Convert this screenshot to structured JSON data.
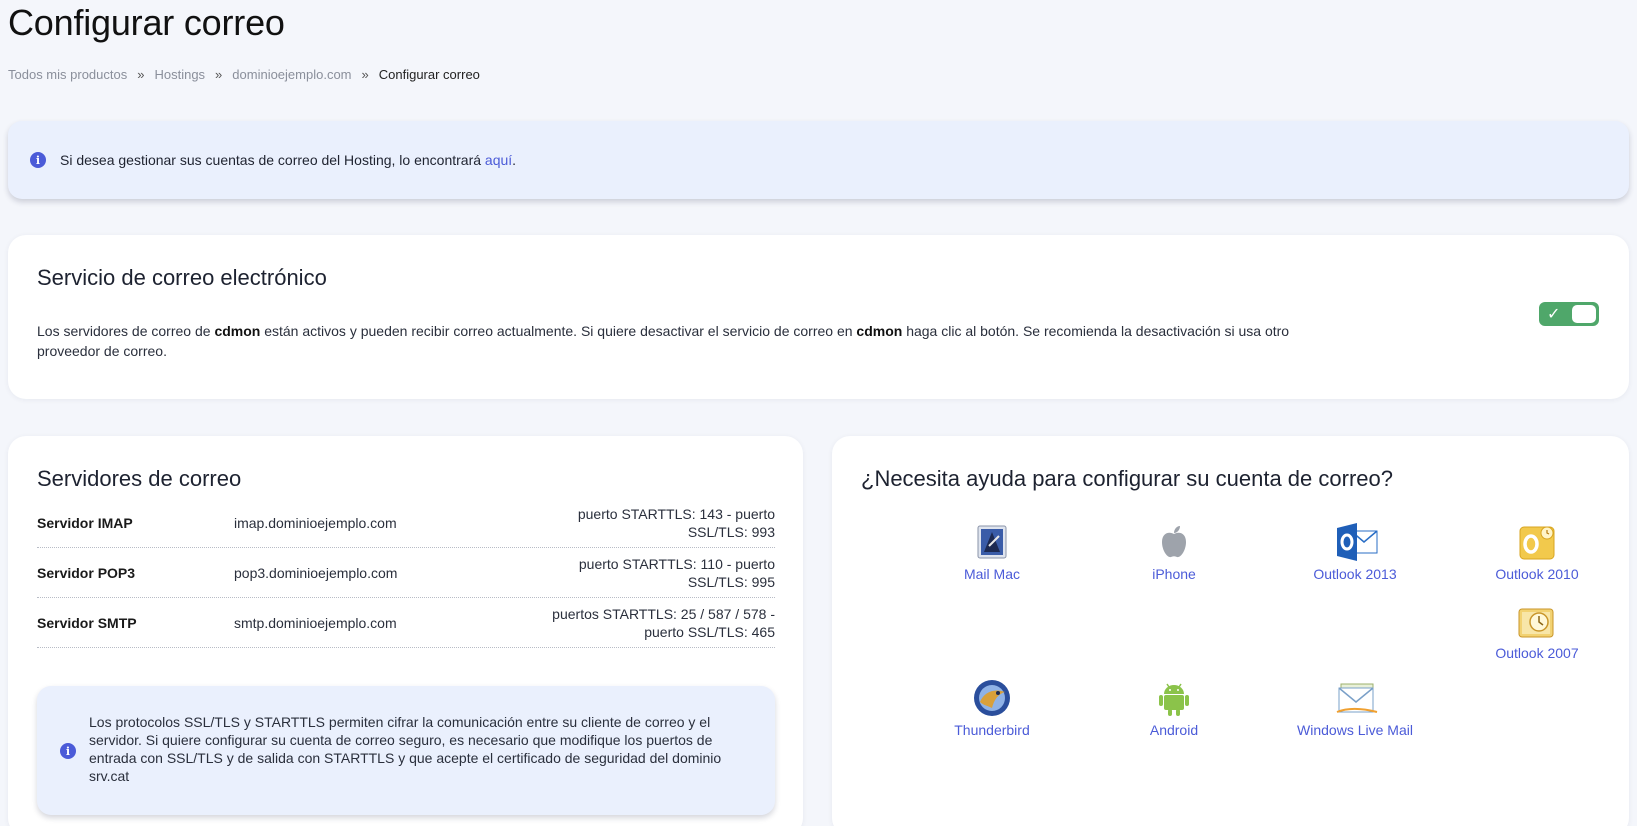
{
  "page_title": "Configurar correo",
  "breadcrumb": [
    {
      "label": "Todos mis productos"
    },
    {
      "label": "Hostings"
    },
    {
      "label": "dominioejemplo.com"
    },
    {
      "label": "Configurar correo"
    }
  ],
  "breadcrumb_separator": "»",
  "banner": {
    "text": "Si desea gestionar sus cuentas de correo del Hosting, lo encontrará ",
    "link": "aquí",
    "suffix": ".",
    "icon": "info-icon"
  },
  "service": {
    "title": "Servicio de correo electrónico",
    "desc_1": "Los servidores de correo de ",
    "brand": "cdmon",
    "desc_2": " están activos y pueden recibir correo actualmente. Si quiere desactivar el servicio de correo en ",
    "desc_3": " haga clic al botón. Se recomienda la desactivación si usa otro proveedor de correo.",
    "toggle_state": "on",
    "toggle_color": "#4fa76a"
  },
  "servers": {
    "title": "Servidores de correo",
    "rows": [
      {
        "name": "Servidor IMAP",
        "host": "imap.dominioejemplo.com",
        "ports": "puerto STARTTLS: 143 - puerto SSL/TLS: 993"
      },
      {
        "name": "Servidor POP3",
        "host": "pop3.dominioejemplo.com",
        "ports": "puerto STARTTLS: 110 - puerto SSL/TLS: 995"
      },
      {
        "name": "Servidor SMTP",
        "host": "smtp.dominioejemplo.com",
        "ports": "puertos STARTTLS: 25 / 587 / 578 - puerto SSL/TLS: 465"
      }
    ],
    "note": "Los protocolos SSL/TLS y STARTTLS permiten cifrar la comunicación entre su cliente de correo y el servidor. Si quiere configurar su cuenta de correo seguro, es necesario que modifique los puertos de entrada con SSL/TLS y de salida con STARTTLS y que acepte el certificado de seguridad del dominio srv.cat"
  },
  "help": {
    "title": "¿Necesita ayuda para configurar su cuenta de correo?",
    "clients": [
      {
        "label": "Mail Mac",
        "icon": "mail-mac-icon"
      },
      {
        "label": "iPhone",
        "icon": "apple-icon"
      },
      {
        "label": "Outlook 2013",
        "icon": "outlook-2013-icon"
      },
      {
        "label": "Outlook 2010",
        "icon": "outlook-2010-icon"
      },
      {
        "label": "Outlook 2007",
        "icon": "outlook-2007-icon"
      },
      {
        "label": "Thunderbird",
        "icon": "thunderbird-icon"
      },
      {
        "label": "Android",
        "icon": "android-icon"
      },
      {
        "label": "Windows Live Mail",
        "icon": "windows-live-mail-icon"
      }
    ]
  },
  "colors": {
    "accent": "#4b5bd8",
    "banner_bg": "#eaf0fd",
    "page_bg": "#f4f6fb"
  }
}
